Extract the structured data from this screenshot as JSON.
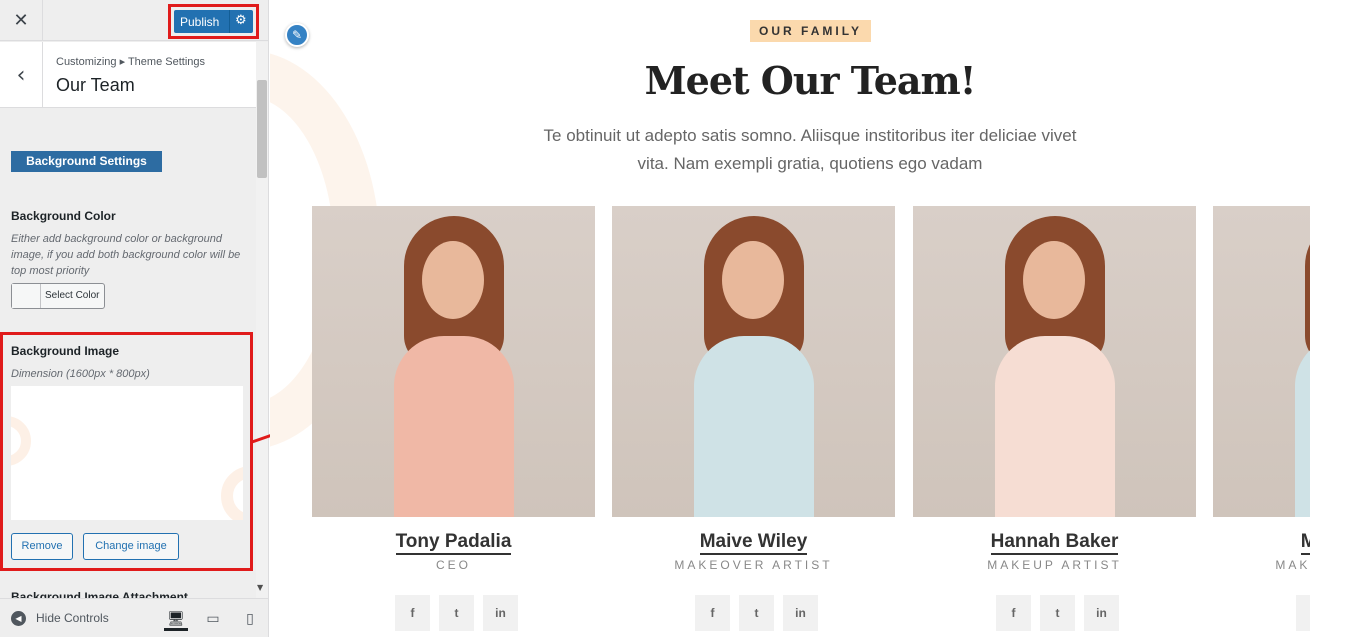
{
  "sidebar": {
    "close_glyph": "✕",
    "publish_label": "Publish",
    "gear_glyph": "⚙",
    "back_glyph": "‹",
    "breadcrumb": "Customizing ▸ Theme Settings",
    "section_title": "Our Team",
    "background_settings_label": "Background Settings",
    "background_color": {
      "label": "Background Color",
      "description": "Either add background color or background image, if you add both background color will be top most priority",
      "select_label": "Select Color"
    },
    "background_image": {
      "label": "Background Image",
      "dimension": "Dimension (1600px * 800px)",
      "remove_label": "Remove",
      "change_label": "Change image"
    },
    "next_label": "Background Image Attachment",
    "footer": {
      "hide_controls_label": "Hide Controls",
      "hide_glyph": "◀",
      "devices": [
        {
          "name": "desktop",
          "glyph": "🖥",
          "active": true
        },
        {
          "name": "tablet",
          "glyph": "▭",
          "active": false
        },
        {
          "name": "mobile",
          "glyph": "▯",
          "active": false
        }
      ]
    },
    "highlight_color": "#e01b1b",
    "accent_color": "#2271b1"
  },
  "preview": {
    "edit_glyph": "✎",
    "eyebrow": "OUR FAMILY",
    "headline": "Meet Our Team!",
    "intro": "Te obtinuit ut adepto satis somno. Aliisque institoribus iter deliciae vivet vita. Nam exempli gratia, quotiens ego vadam",
    "members": [
      {
        "name": "Tony Padalia",
        "role": "CEO",
        "outfit_color": "#f0b8a6"
      },
      {
        "name": "Maive Wiley",
        "role": "MAKEOVER ARTIST",
        "outfit_color": "#cfe2e6"
      },
      {
        "name": "Hannah Baker",
        "role": "MAKEUP ARTIST",
        "outfit_color": "#f6ddd3"
      },
      {
        "name": "Maive Wiley",
        "role": "MAKEOVER ARTIST",
        "outfit_color": "#cfe2e6"
      }
    ],
    "social_icons": [
      {
        "name": "facebook-icon",
        "glyph": "f"
      },
      {
        "name": "twitter-icon",
        "glyph": "t"
      },
      {
        "name": "linkedin-icon",
        "glyph": "in"
      }
    ]
  }
}
